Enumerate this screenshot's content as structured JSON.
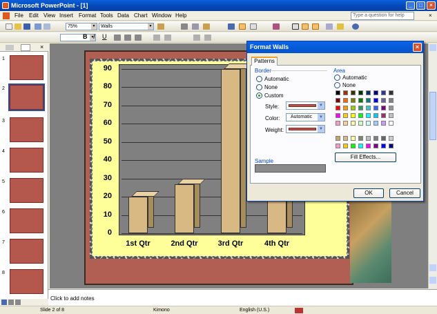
{
  "window": {
    "title": "Microsoft PowerPoint - [1]"
  },
  "menu": [
    "File",
    "Edit",
    "View",
    "Insert",
    "Format",
    "Tools",
    "Data",
    "Chart",
    "Window",
    "Help"
  ],
  "help_placeholder": "Type a question for help",
  "toolbar": {
    "zoom": "75%",
    "chart_object": "Walls"
  },
  "slides_panel": {
    "numbers": [
      "1",
      "2",
      "3",
      "4",
      "5",
      "6",
      "7",
      "8"
    ],
    "selected": "2"
  },
  "chart_data": {
    "type": "bar",
    "categories": [
      "1st Qtr",
      "2nd Qtr",
      "3rd Qtr",
      "4th Qtr"
    ],
    "values": [
      20,
      27,
      90,
      20
    ],
    "ylim": [
      0,
      90
    ],
    "yticks": [
      "0",
      "10",
      "20",
      "30",
      "40",
      "50",
      "60",
      "70",
      "80",
      "90"
    ],
    "colors": {
      "bar": "#d9b983",
      "wall": "#808080",
      "background": "#ffff99"
    }
  },
  "dialog": {
    "title": "Format Walls",
    "tab": "Patterns",
    "border_label": "Border",
    "border_options": [
      "Automatic",
      "None",
      "Custom"
    ],
    "style_label": "Style:",
    "color_label": "Color:",
    "color_value": "Automatic",
    "weight_label": "Weight:",
    "sample_label": "Sample",
    "area_label": "Area",
    "area_options": [
      "Automatic",
      "None"
    ],
    "fill_effects": "Fill Effects...",
    "ok": "OK",
    "cancel": "Cancel"
  },
  "notes_placeholder": "Click to add notes",
  "status": {
    "slide": "Slide 2 of 8",
    "design": "Kimono",
    "language": "English (U.S.)"
  }
}
